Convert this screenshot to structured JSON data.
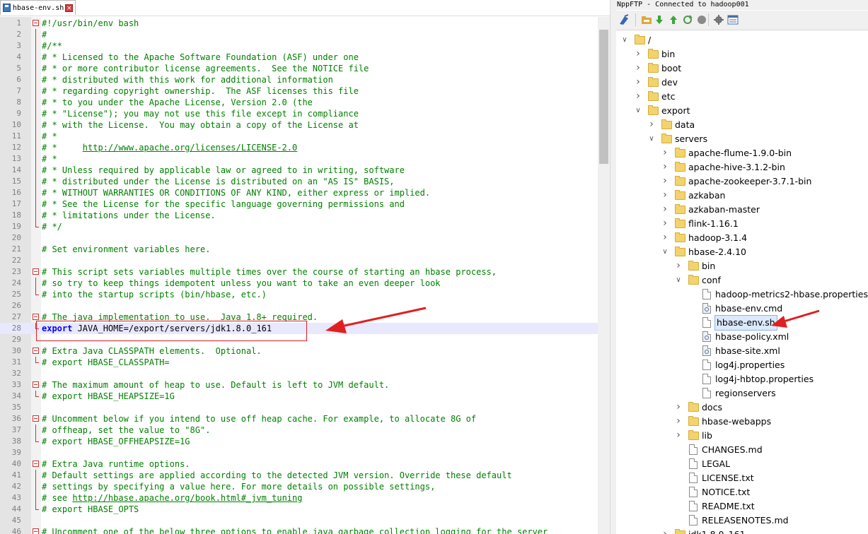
{
  "editor": {
    "tab_label": "hbase-env.sh",
    "lines": [
      {
        "n": "1",
        "text": "#!/usr/bin/env bash",
        "fold": "start"
      },
      {
        "n": "2",
        "text": "#"
      },
      {
        "n": "3",
        "text": "#/**"
      },
      {
        "n": "4",
        "text": "# * Licensed to the Apache Software Foundation (ASF) under one"
      },
      {
        "n": "5",
        "text": "# * or more contributor license agreements.  See the NOTICE file"
      },
      {
        "n": "6",
        "text": "# * distributed with this work for additional information"
      },
      {
        "n": "7",
        "text": "# * regarding copyright ownership.  The ASF licenses this file"
      },
      {
        "n": "8",
        "text": "# * to you under the Apache License, Version 2.0 (the"
      },
      {
        "n": "9",
        "text": "# * \"License\"); you may not use this file except in compliance"
      },
      {
        "n": "10",
        "text": "# * with the License.  You may obtain a copy of the License at"
      },
      {
        "n": "11",
        "text": "# *"
      },
      {
        "n": "12",
        "text": "# *     ",
        "url": "http://www.apache.org/licenses/LICENSE-2.0"
      },
      {
        "n": "13",
        "text": "# *"
      },
      {
        "n": "14",
        "text": "# * Unless required by applicable law or agreed to in writing, software"
      },
      {
        "n": "15",
        "text": "# * distributed under the License is distributed on an \"AS IS\" BASIS,"
      },
      {
        "n": "16",
        "text": "# * WITHOUT WARRANTIES OR CONDITIONS OF ANY KIND, either express or implied."
      },
      {
        "n": "17",
        "text": "# * See the License for the specific language governing permissions and"
      },
      {
        "n": "18",
        "text": "# * limitations under the License."
      },
      {
        "n": "19",
        "text": "# */",
        "fold": "end"
      },
      {
        "n": "20",
        "text": ""
      },
      {
        "n": "21",
        "text": "# Set environment variables here."
      },
      {
        "n": "22",
        "text": ""
      },
      {
        "n": "23",
        "text": "# This script sets variables multiple times over the course of starting an hbase process,",
        "fold": "start"
      },
      {
        "n": "24",
        "text": "# so try to keep things idempotent unless you want to take an even deeper look"
      },
      {
        "n": "25",
        "text": "# into the startup scripts (bin/hbase, etc.)",
        "fold": "end"
      },
      {
        "n": "26",
        "text": ""
      },
      {
        "n": "27",
        "text": "# The java implementation to use.  Java 1.8+ required.",
        "fold": "start"
      },
      {
        "n": "28",
        "kw": "export",
        "text": " JAVA_HOME=/export/servers/jdk1.8.0_161",
        "current": true,
        "fold": "end"
      },
      {
        "n": "29",
        "text": ""
      },
      {
        "n": "30",
        "text": "# Extra Java CLASSPATH elements.  Optional.",
        "fold": "start"
      },
      {
        "n": "31",
        "text": "# export HBASE_CLASSPATH=",
        "fold": "end"
      },
      {
        "n": "32",
        "text": ""
      },
      {
        "n": "33",
        "text": "# The maximum amount of heap to use. Default is left to JVM default.",
        "fold": "start"
      },
      {
        "n": "34",
        "text": "# export HBASE_HEAPSIZE=1G",
        "fold": "end"
      },
      {
        "n": "35",
        "text": ""
      },
      {
        "n": "36",
        "text": "# Uncomment below if you intend to use off heap cache. For example, to allocate 8G of",
        "fold": "start"
      },
      {
        "n": "37",
        "text": "# offheap, set the value to \"8G\"."
      },
      {
        "n": "38",
        "text": "# export HBASE_OFFHEAPSIZE=1G",
        "fold": "end"
      },
      {
        "n": "39",
        "text": ""
      },
      {
        "n": "40",
        "text": "# Extra Java runtime options.",
        "fold": "start"
      },
      {
        "n": "41",
        "text": "# Default settings are applied according to the detected JVM version. Override these default"
      },
      {
        "n": "42",
        "text": "# settings by specifying a value here. For more details on possible settings,"
      },
      {
        "n": "43",
        "text": "# see ",
        "url": "http://hbase.apache.org/book.html#_jvm_tuning"
      },
      {
        "n": "44",
        "text": "# export HBASE_OPTS",
        "fold": "end"
      },
      {
        "n": "45",
        "text": ""
      },
      {
        "n": "46",
        "text": "# Uncomment one of the below three options to enable java garbage collection logging for the server",
        "fold": "start"
      }
    ]
  },
  "ftp": {
    "title": "NppFTP - Connected to hadoop001",
    "toolbar": [
      {
        "name": "connect-icon",
        "color": "#3a66b8"
      },
      {
        "name": "open-folder-icon",
        "color": "#d9a93b"
      },
      {
        "name": "download-icon",
        "color": "#3aa63a"
      },
      {
        "name": "upload-icon",
        "color": "#3aa63a"
      },
      {
        "name": "refresh-icon",
        "color": "#4a9a4a"
      },
      {
        "name": "abort-icon",
        "color": "#8a8a8a"
      },
      {
        "name": "settings-icon",
        "color": "#707070"
      },
      {
        "name": "message-window-icon",
        "color": "#4a6ea8"
      }
    ],
    "tree": [
      {
        "label": "/",
        "depth": 0,
        "type": "folder",
        "expanded": true
      },
      {
        "label": "bin",
        "depth": 1,
        "type": "folder",
        "expanded": false
      },
      {
        "label": "boot",
        "depth": 1,
        "type": "folder",
        "expanded": false
      },
      {
        "label": "dev",
        "depth": 1,
        "type": "folder",
        "expanded": false
      },
      {
        "label": "etc",
        "depth": 1,
        "type": "folder",
        "expanded": false
      },
      {
        "label": "export",
        "depth": 1,
        "type": "folder",
        "expanded": true
      },
      {
        "label": "data",
        "depth": 2,
        "type": "folder",
        "expanded": false
      },
      {
        "label": "servers",
        "depth": 2,
        "type": "folder",
        "expanded": true
      },
      {
        "label": "apache-flume-1.9.0-bin",
        "depth": 3,
        "type": "folder",
        "expanded": false
      },
      {
        "label": "apache-hive-3.1.2-bin",
        "depth": 3,
        "type": "folder",
        "expanded": false
      },
      {
        "label": "apache-zookeeper-3.7.1-bin",
        "depth": 3,
        "type": "folder",
        "expanded": false
      },
      {
        "label": "azkaban",
        "depth": 3,
        "type": "folder",
        "expanded": false
      },
      {
        "label": "azkaban-master",
        "depth": 3,
        "type": "folder",
        "expanded": false
      },
      {
        "label": "flink-1.16.1",
        "depth": 3,
        "type": "folder",
        "expanded": false
      },
      {
        "label": "hadoop-3.1.4",
        "depth": 3,
        "type": "folder",
        "expanded": false
      },
      {
        "label": "hbase-2.4.10",
        "depth": 3,
        "type": "folder",
        "expanded": true
      },
      {
        "label": "bin",
        "depth": 4,
        "type": "folder",
        "expanded": false
      },
      {
        "label": "conf",
        "depth": 4,
        "type": "folder",
        "expanded": true
      },
      {
        "label": "hadoop-metrics2-hbase.properties",
        "depth": 5,
        "type": "file"
      },
      {
        "label": "hbase-env.cmd",
        "depth": 5,
        "type": "file",
        "kind": "cfg"
      },
      {
        "label": "hbase-env.sh",
        "depth": 5,
        "type": "file",
        "selected": true
      },
      {
        "label": "hbase-policy.xml",
        "depth": 5,
        "type": "file",
        "kind": "cfg"
      },
      {
        "label": "hbase-site.xml",
        "depth": 5,
        "type": "file",
        "kind": "cfg"
      },
      {
        "label": "log4j.properties",
        "depth": 5,
        "type": "file"
      },
      {
        "label": "log4j-hbtop.properties",
        "depth": 5,
        "type": "file"
      },
      {
        "label": "regionservers",
        "depth": 5,
        "type": "file"
      },
      {
        "label": "docs",
        "depth": 4,
        "type": "folder",
        "expanded": false
      },
      {
        "label": "hbase-webapps",
        "depth": 4,
        "type": "folder",
        "expanded": false
      },
      {
        "label": "lib",
        "depth": 4,
        "type": "folder",
        "expanded": false
      },
      {
        "label": "CHANGES.md",
        "depth": 4,
        "type": "file"
      },
      {
        "label": "LEGAL",
        "depth": 4,
        "type": "file"
      },
      {
        "label": "LICENSE.txt",
        "depth": 4,
        "type": "file"
      },
      {
        "label": "NOTICE.txt",
        "depth": 4,
        "type": "file"
      },
      {
        "label": "README.txt",
        "depth": 4,
        "type": "file"
      },
      {
        "label": "RELEASENOTES.md",
        "depth": 4,
        "type": "file"
      },
      {
        "label": "jdk1.8.0_161",
        "depth": 3,
        "type": "folder",
        "expanded": false
      }
    ]
  },
  "colors": {
    "comment": "#008000",
    "keyword": "#0000ff",
    "annotation_red": "#e02020",
    "gutter": "#e4e4e4",
    "current_line": "#e8e8ff",
    "selection": "#dbe9fb"
  }
}
